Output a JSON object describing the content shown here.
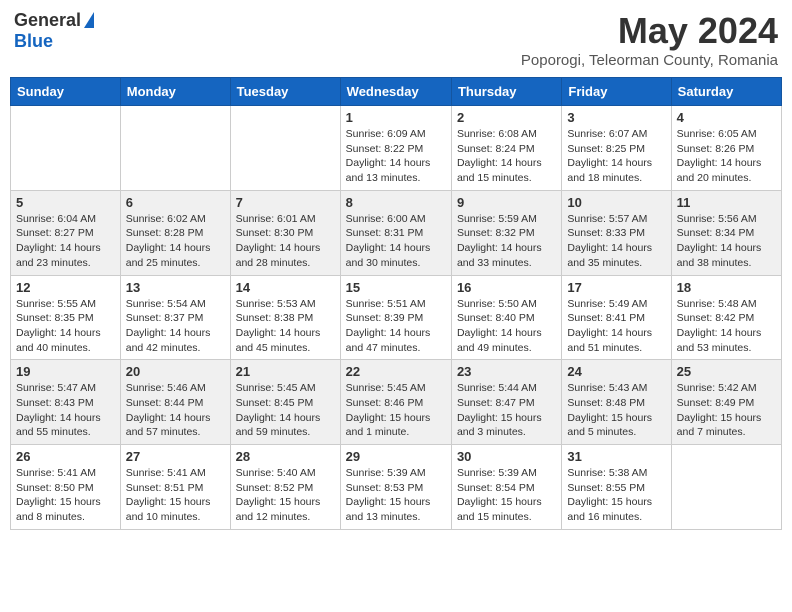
{
  "logo": {
    "general": "General",
    "blue": "Blue"
  },
  "title": "May 2024",
  "subtitle": "Poporogi, Teleorman County, Romania",
  "weekdays": [
    "Sunday",
    "Monday",
    "Tuesday",
    "Wednesday",
    "Thursday",
    "Friday",
    "Saturday"
  ],
  "weeks": [
    [
      {
        "day": "",
        "sunrise": "",
        "sunset": "",
        "daylight": ""
      },
      {
        "day": "",
        "sunrise": "",
        "sunset": "",
        "daylight": ""
      },
      {
        "day": "",
        "sunrise": "",
        "sunset": "",
        "daylight": ""
      },
      {
        "day": "1",
        "sunrise": "Sunrise: 6:09 AM",
        "sunset": "Sunset: 8:22 PM",
        "daylight": "Daylight: 14 hours and 13 minutes."
      },
      {
        "day": "2",
        "sunrise": "Sunrise: 6:08 AM",
        "sunset": "Sunset: 8:24 PM",
        "daylight": "Daylight: 14 hours and 15 minutes."
      },
      {
        "day": "3",
        "sunrise": "Sunrise: 6:07 AM",
        "sunset": "Sunset: 8:25 PM",
        "daylight": "Daylight: 14 hours and 18 minutes."
      },
      {
        "day": "4",
        "sunrise": "Sunrise: 6:05 AM",
        "sunset": "Sunset: 8:26 PM",
        "daylight": "Daylight: 14 hours and 20 minutes."
      }
    ],
    [
      {
        "day": "5",
        "sunrise": "Sunrise: 6:04 AM",
        "sunset": "Sunset: 8:27 PM",
        "daylight": "Daylight: 14 hours and 23 minutes."
      },
      {
        "day": "6",
        "sunrise": "Sunrise: 6:02 AM",
        "sunset": "Sunset: 8:28 PM",
        "daylight": "Daylight: 14 hours and 25 minutes."
      },
      {
        "day": "7",
        "sunrise": "Sunrise: 6:01 AM",
        "sunset": "Sunset: 8:30 PM",
        "daylight": "Daylight: 14 hours and 28 minutes."
      },
      {
        "day": "8",
        "sunrise": "Sunrise: 6:00 AM",
        "sunset": "Sunset: 8:31 PM",
        "daylight": "Daylight: 14 hours and 30 minutes."
      },
      {
        "day": "9",
        "sunrise": "Sunrise: 5:59 AM",
        "sunset": "Sunset: 8:32 PM",
        "daylight": "Daylight: 14 hours and 33 minutes."
      },
      {
        "day": "10",
        "sunrise": "Sunrise: 5:57 AM",
        "sunset": "Sunset: 8:33 PM",
        "daylight": "Daylight: 14 hours and 35 minutes."
      },
      {
        "day": "11",
        "sunrise": "Sunrise: 5:56 AM",
        "sunset": "Sunset: 8:34 PM",
        "daylight": "Daylight: 14 hours and 38 minutes."
      }
    ],
    [
      {
        "day": "12",
        "sunrise": "Sunrise: 5:55 AM",
        "sunset": "Sunset: 8:35 PM",
        "daylight": "Daylight: 14 hours and 40 minutes."
      },
      {
        "day": "13",
        "sunrise": "Sunrise: 5:54 AM",
        "sunset": "Sunset: 8:37 PM",
        "daylight": "Daylight: 14 hours and 42 minutes."
      },
      {
        "day": "14",
        "sunrise": "Sunrise: 5:53 AM",
        "sunset": "Sunset: 8:38 PM",
        "daylight": "Daylight: 14 hours and 45 minutes."
      },
      {
        "day": "15",
        "sunrise": "Sunrise: 5:51 AM",
        "sunset": "Sunset: 8:39 PM",
        "daylight": "Daylight: 14 hours and 47 minutes."
      },
      {
        "day": "16",
        "sunrise": "Sunrise: 5:50 AM",
        "sunset": "Sunset: 8:40 PM",
        "daylight": "Daylight: 14 hours and 49 minutes."
      },
      {
        "day": "17",
        "sunrise": "Sunrise: 5:49 AM",
        "sunset": "Sunset: 8:41 PM",
        "daylight": "Daylight: 14 hours and 51 minutes."
      },
      {
        "day": "18",
        "sunrise": "Sunrise: 5:48 AM",
        "sunset": "Sunset: 8:42 PM",
        "daylight": "Daylight: 14 hours and 53 minutes."
      }
    ],
    [
      {
        "day": "19",
        "sunrise": "Sunrise: 5:47 AM",
        "sunset": "Sunset: 8:43 PM",
        "daylight": "Daylight: 14 hours and 55 minutes."
      },
      {
        "day": "20",
        "sunrise": "Sunrise: 5:46 AM",
        "sunset": "Sunset: 8:44 PM",
        "daylight": "Daylight: 14 hours and 57 minutes."
      },
      {
        "day": "21",
        "sunrise": "Sunrise: 5:45 AM",
        "sunset": "Sunset: 8:45 PM",
        "daylight": "Daylight: 14 hours and 59 minutes."
      },
      {
        "day": "22",
        "sunrise": "Sunrise: 5:45 AM",
        "sunset": "Sunset: 8:46 PM",
        "daylight": "Daylight: 15 hours and 1 minute."
      },
      {
        "day": "23",
        "sunrise": "Sunrise: 5:44 AM",
        "sunset": "Sunset: 8:47 PM",
        "daylight": "Daylight: 15 hours and 3 minutes."
      },
      {
        "day": "24",
        "sunrise": "Sunrise: 5:43 AM",
        "sunset": "Sunset: 8:48 PM",
        "daylight": "Daylight: 15 hours and 5 minutes."
      },
      {
        "day": "25",
        "sunrise": "Sunrise: 5:42 AM",
        "sunset": "Sunset: 8:49 PM",
        "daylight": "Daylight: 15 hours and 7 minutes."
      }
    ],
    [
      {
        "day": "26",
        "sunrise": "Sunrise: 5:41 AM",
        "sunset": "Sunset: 8:50 PM",
        "daylight": "Daylight: 15 hours and 8 minutes."
      },
      {
        "day": "27",
        "sunrise": "Sunrise: 5:41 AM",
        "sunset": "Sunset: 8:51 PM",
        "daylight": "Daylight: 15 hours and 10 minutes."
      },
      {
        "day": "28",
        "sunrise": "Sunrise: 5:40 AM",
        "sunset": "Sunset: 8:52 PM",
        "daylight": "Daylight: 15 hours and 12 minutes."
      },
      {
        "day": "29",
        "sunrise": "Sunrise: 5:39 AM",
        "sunset": "Sunset: 8:53 PM",
        "daylight": "Daylight: 15 hours and 13 minutes."
      },
      {
        "day": "30",
        "sunrise": "Sunrise: 5:39 AM",
        "sunset": "Sunset: 8:54 PM",
        "daylight": "Daylight: 15 hours and 15 minutes."
      },
      {
        "day": "31",
        "sunrise": "Sunrise: 5:38 AM",
        "sunset": "Sunset: 8:55 PM",
        "daylight": "Daylight: 15 hours and 16 minutes."
      },
      {
        "day": "",
        "sunrise": "",
        "sunset": "",
        "daylight": ""
      }
    ]
  ]
}
